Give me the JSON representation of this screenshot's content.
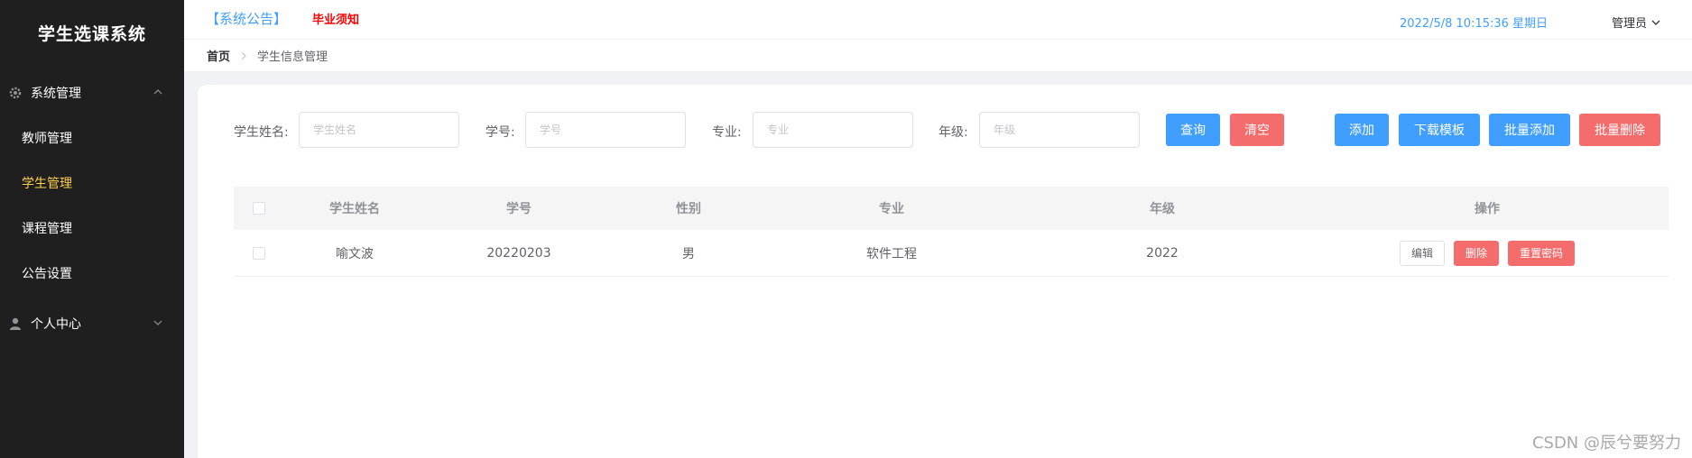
{
  "app": {
    "title": "学生选课系统"
  },
  "sidebar": {
    "groups": [
      {
        "label": "系统管理",
        "icon": "gear-icon",
        "expanded": true
      },
      {
        "label": "个人中心",
        "icon": "user-icon",
        "expanded": false
      }
    ],
    "items": [
      {
        "label": "教师管理",
        "active": false
      },
      {
        "label": "学生管理",
        "active": true
      },
      {
        "label": "课程管理",
        "active": false
      },
      {
        "label": "公告设置",
        "active": false
      }
    ]
  },
  "header": {
    "notice_label": "【系统公告】",
    "notice_link": "毕业须知",
    "datetime": "2022/5/8 10:15:36 星期日",
    "user": "管理员"
  },
  "breadcrumb": {
    "home": "首页",
    "current": "学生信息管理"
  },
  "search": {
    "name_label": "学生姓名:",
    "name_placeholder": "学生姓名",
    "name_value": "",
    "no_label": "学号:",
    "no_placeholder": "学号",
    "no_value": "",
    "major_label": "专业:",
    "major_placeholder": "专业",
    "major_value": "",
    "grade_label": "年级:",
    "grade_placeholder": "年级",
    "grade_value": ""
  },
  "toolbar": {
    "query": "查询",
    "clear": "清空",
    "add": "添加",
    "download_template": "下载模板",
    "batch_add": "批量添加",
    "batch_delete": "批量删除"
  },
  "table": {
    "columns": [
      "学生姓名",
      "学号",
      "性别",
      "专业",
      "年级",
      "操作"
    ],
    "rows": [
      {
        "name": "喻文波",
        "no": "20220203",
        "sex": "男",
        "major": "软件工程",
        "grade": "2022"
      }
    ],
    "actions": {
      "edit": "编辑",
      "delete": "删除",
      "reset_password": "重置密码"
    }
  },
  "watermark": "CSDN @辰兮要努力",
  "colors": {
    "sidebar_bg": "#1f1f1f",
    "active_menu": "#ffd04b",
    "primary": "#409eff",
    "danger": "#f56c6c",
    "notice_link": "#ff0000"
  }
}
